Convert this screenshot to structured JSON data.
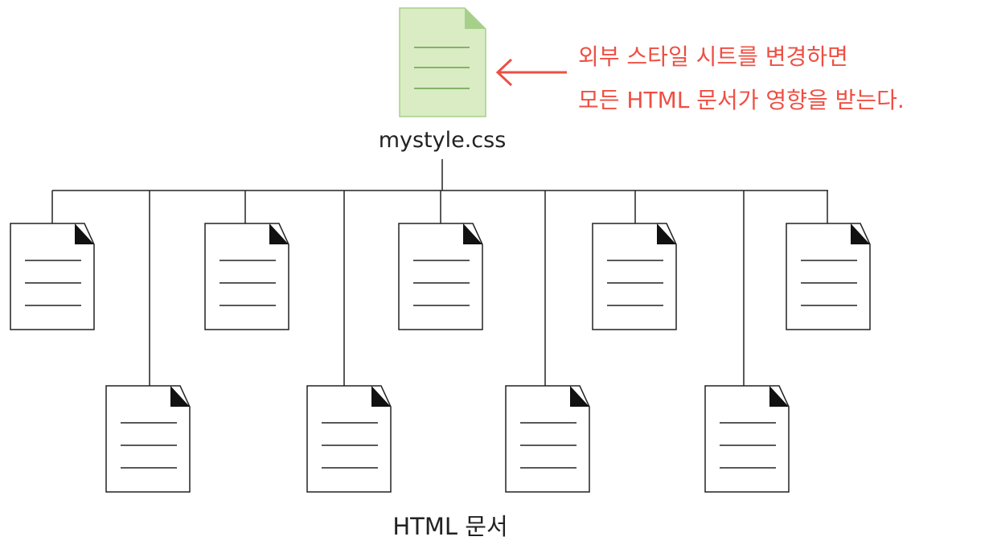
{
  "css_file": {
    "filename": "mystyle.css",
    "fill_color": "#d9ecc4",
    "stroke_color": "#a6d08a",
    "line_color": "#6a9e48"
  },
  "annotation": {
    "line1": "외부 스타일 시트를 변경하면",
    "line2": "모든 HTML 문서가 영향을 받는다.",
    "color": "#ee4f43"
  },
  "documents": {
    "label": "HTML 문서",
    "count": 9
  }
}
